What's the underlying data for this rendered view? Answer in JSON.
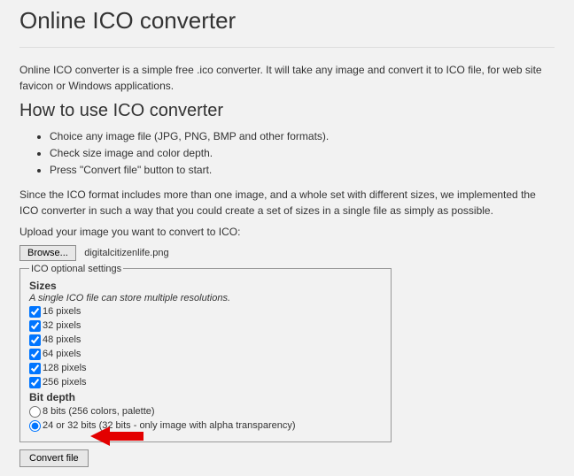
{
  "title": "Online ICO converter",
  "intro": "Online ICO converter is a simple free .ico converter. It will take any image and convert it to ICO file, for web site favicon or Windows applications.",
  "howto_heading": "How to use ICO converter",
  "howto_items": [
    "Choice any image file (JPG, PNG, BMP and other formats).",
    "Check size image and color depth.",
    "Press \"Convert file\" button to start."
  ],
  "note": "Since the ICO format includes more than one image, and a whole set with different sizes, we implemented the ICO converter in such a way that you could create a set of sizes in a single file as simply as possible.",
  "upload_label": "Upload your image you want to convert to ICO:",
  "browse_label": "Browse...",
  "selected_file": "digitalcitizenlife.png",
  "fieldset_legend": "ICO optional settings",
  "sizes_title": "Sizes",
  "sizes_hint": "A single ICO file can store multiple resolutions.",
  "sizes": [
    {
      "label": "16 pixels",
      "checked": true
    },
    {
      "label": "32 pixels",
      "checked": true
    },
    {
      "label": "48 pixels",
      "checked": true
    },
    {
      "label": "64 pixels",
      "checked": true
    },
    {
      "label": "128 pixels",
      "checked": true
    },
    {
      "label": "256 pixels",
      "checked": true
    }
  ],
  "bitdepth_title": "Bit depth",
  "bitdepth": [
    {
      "label": "8 bits (256 colors, palette)",
      "checked": false
    },
    {
      "label": "24 or 32 bits (32 bits - only image with alpha transparency)",
      "checked": true
    }
  ],
  "convert_label": "Convert file"
}
